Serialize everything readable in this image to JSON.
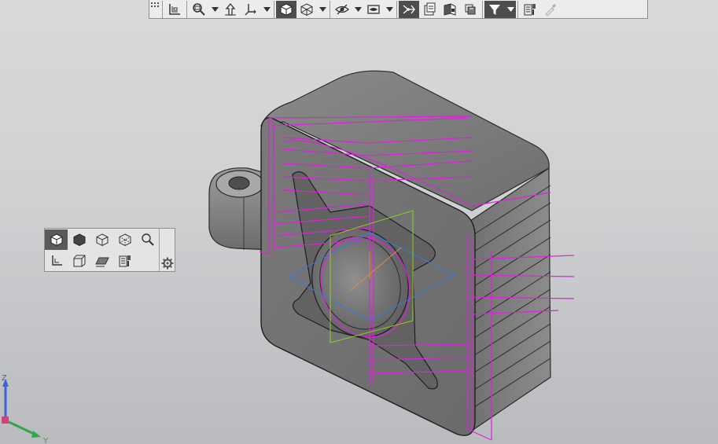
{
  "viewport": {
    "background_top": "#d9dadc",
    "background_bottom": "#b9bbbe",
    "curve_color": "#e020e0",
    "body_color": "#7a7a7a"
  },
  "toolbar": {
    "groups": [
      {
        "icon": "grip-icon"
      },
      {
        "icon": "coordinate-system-icon"
      },
      {
        "icon": "zoom-window-icon",
        "dropdown": true
      },
      {
        "icon": "orient-icon"
      },
      {
        "icon": "orientation-triad-icon",
        "dropdown": true
      },
      {
        "icon": "shaded-with-edges-icon",
        "active": true
      },
      {
        "icon": "wireframe-icon",
        "dropdown": true
      },
      {
        "icon": "hide-show-icon",
        "dropdown": true
      },
      {
        "icon": "view-camera-icon",
        "dropdown": true
      },
      {
        "icon": "curves-visibility-icon",
        "active": true
      },
      {
        "icon": "layers-icon"
      },
      {
        "icon": "section-view-icon"
      },
      {
        "icon": "component-display-icon"
      },
      {
        "icon": "filter-icon",
        "active": true,
        "dropdown": true
      },
      {
        "icon": "properties-icon"
      },
      {
        "icon": "eyedropper-icon"
      }
    ]
  },
  "view_panel": {
    "row1": [
      "shaded-with-edges-icon",
      "shaded-icon",
      "wireframe-icon",
      "hidden-lines-icon",
      "zoom-icon"
    ],
    "row2": [
      "axes-icon",
      "perspective-icon",
      "plane-icon",
      "component-icon"
    ],
    "gear": "settings-gear-icon"
  },
  "triad": {
    "z_label": "Z",
    "y_label": "Y",
    "z_color": "#3c63d6",
    "y_color": "#2fa84a"
  }
}
